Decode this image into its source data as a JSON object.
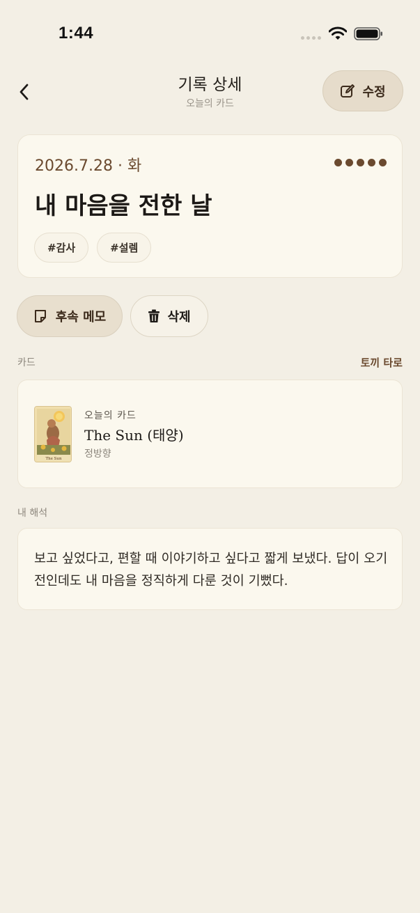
{
  "status_bar": {
    "time": "1:44"
  },
  "header": {
    "title": "기록 상세",
    "subtitle": "오늘의 카드",
    "edit_label": "수정"
  },
  "entry": {
    "date": "2026.7.28 · 화",
    "title": "내 마음을 전한 날",
    "tags": [
      "#감사",
      "#설렘"
    ],
    "rating": 5
  },
  "actions": {
    "memo_label": "후속 메모",
    "delete_label": "삭제"
  },
  "card_section": {
    "label": "카드",
    "deck": "토끼 타로",
    "caption": "오늘의 카드",
    "card_name": "The Sun (태양)",
    "orientation": "정방향",
    "thumb_text": "The Sun"
  },
  "interpretation": {
    "label": "내 해석",
    "text": "보고 싶었다고, 편할 때 이야기하고 싶다고 짧게 보냈다. 답이 오기 전인데도 내 마음을 정직하게 다룬 것이 기뻤다."
  },
  "colors": {
    "background": "#f3efe5",
    "card": "#fbf8ee",
    "accent_brown": "#6b4a2f",
    "button_fill": "#e6dccb"
  }
}
